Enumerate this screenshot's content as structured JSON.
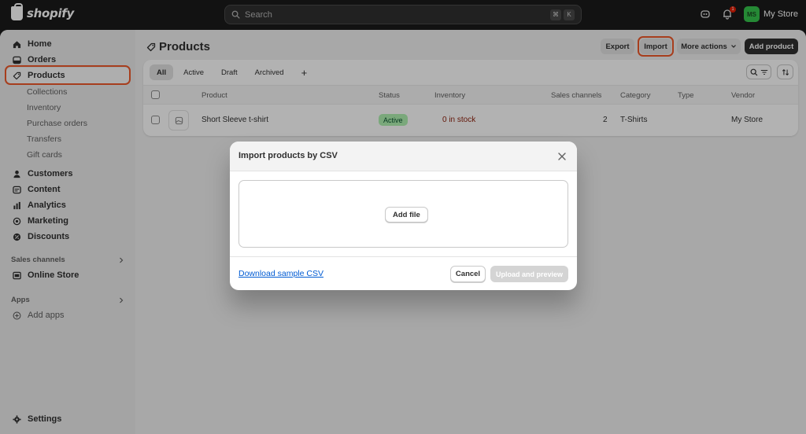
{
  "topbar": {
    "brand": "shopify",
    "search_placeholder": "Search",
    "shortcut_keys": [
      "⌘",
      "K"
    ],
    "notification_count": "1",
    "avatar_initials": "MS",
    "store_name": "My Store"
  },
  "sidebar": {
    "items": [
      {
        "label": "Home",
        "icon": "home-icon"
      },
      {
        "label": "Orders",
        "icon": "orders-icon"
      },
      {
        "label": "Products",
        "icon": "tag-icon",
        "active": true
      }
    ],
    "product_subitems": [
      "Collections",
      "Inventory",
      "Purchase orders",
      "Transfers",
      "Gift cards"
    ],
    "items2": [
      {
        "label": "Customers",
        "icon": "person-icon"
      },
      {
        "label": "Content",
        "icon": "content-icon"
      },
      {
        "label": "Analytics",
        "icon": "analytics-icon"
      },
      {
        "label": "Marketing",
        "icon": "marketing-icon"
      },
      {
        "label": "Discounts",
        "icon": "discount-icon"
      }
    ],
    "sales_channels_label": "Sales channels",
    "online_store": "Online Store",
    "apps_label": "Apps",
    "add_apps": "Add apps",
    "settings": "Settings"
  },
  "page": {
    "title": "Products",
    "export_label": "Export",
    "import_label": "Import",
    "more_actions_label": "More actions",
    "add_product_label": "Add product",
    "tabs": [
      "All",
      "Active",
      "Draft",
      "Archived"
    ],
    "add_tab": "+",
    "columns": [
      "Product",
      "Status",
      "Inventory",
      "Sales channels",
      "Category",
      "Type",
      "Vendor"
    ],
    "rows": [
      {
        "product": "Short Sleeve t-shirt",
        "status": "Active",
        "inventory": "0 in stock",
        "sales_channels": "2",
        "category": "T-Shirts",
        "type": "",
        "vendor": "My Store"
      }
    ]
  },
  "modal": {
    "title": "Import products by CSV",
    "add_file_label": "Add file",
    "download_link": "Download sample CSV",
    "cancel_label": "Cancel",
    "upload_label": "Upload and preview"
  },
  "colors": {
    "highlight": "#f0592a",
    "link": "#005bd3",
    "active_badge_bg": "#aff1b0",
    "inventory_red": "#8e1f0b",
    "avatar_green": "#36c44d"
  }
}
